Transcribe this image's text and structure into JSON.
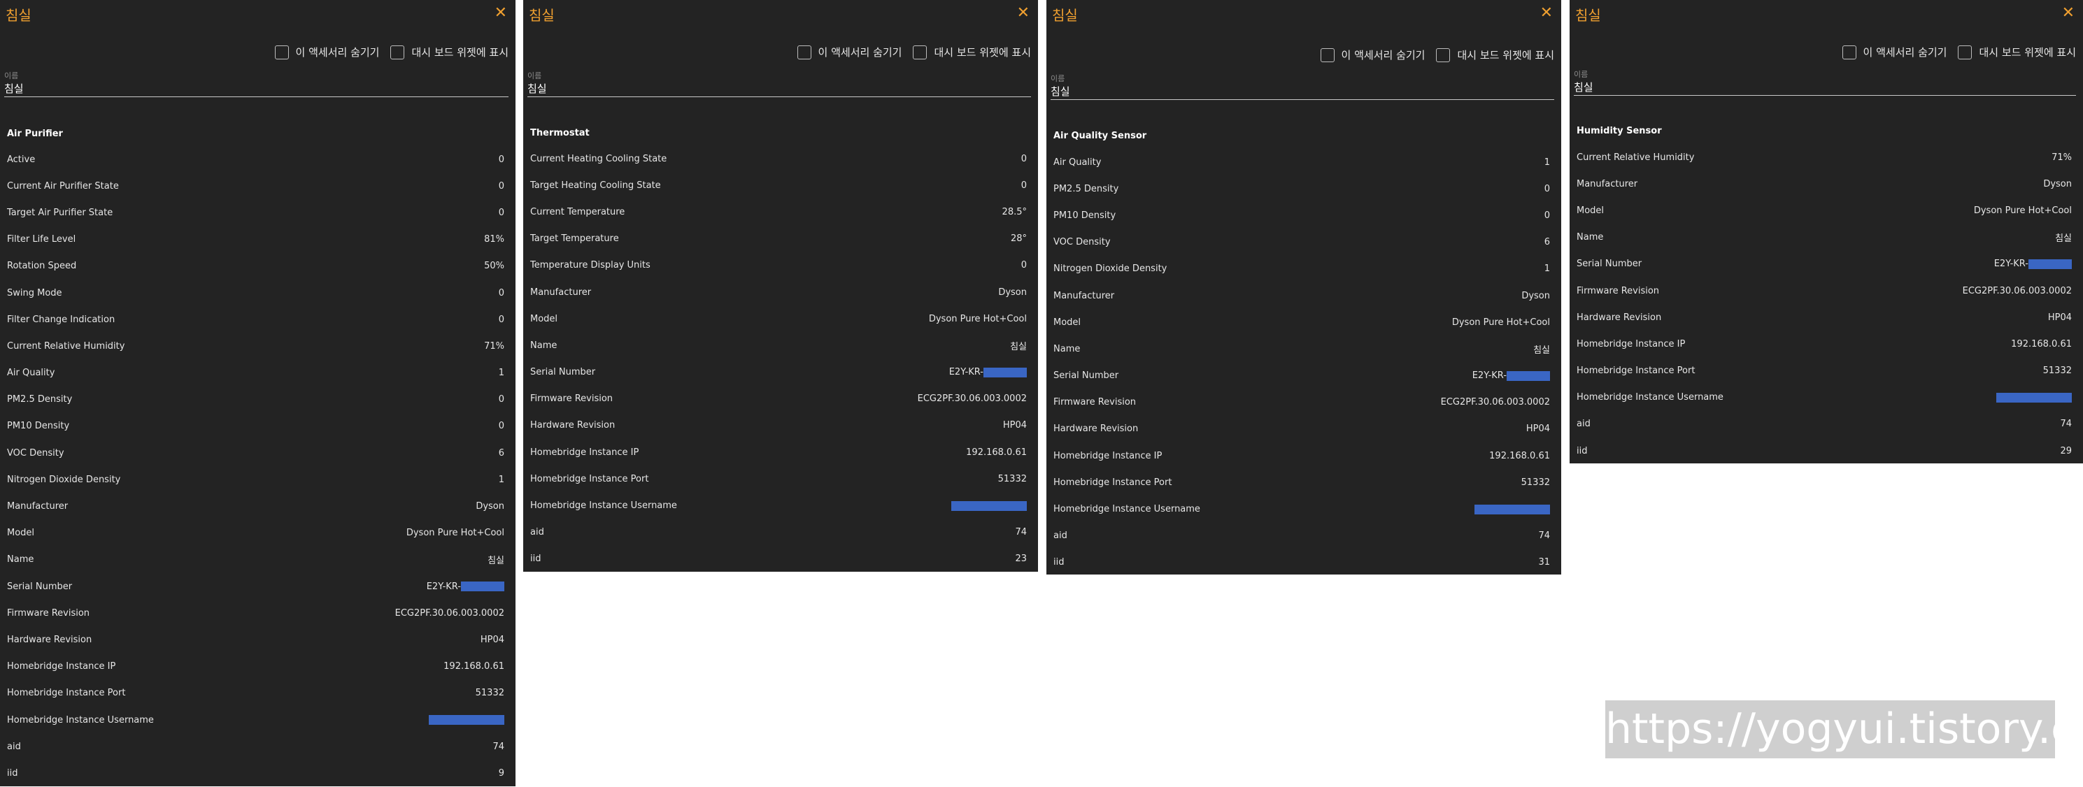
{
  "panels": [
    {
      "title": "침실",
      "hide_accessory_label": "이 액세서리 숨기기",
      "dashboard_widget_label": "대시 보드 위젯에 표시",
      "name_label": "이름",
      "name_value": "침실",
      "section": "Air Purifier",
      "rows": [
        {
          "label": "Active",
          "value": "0"
        },
        {
          "label": "Current Air Purifier State",
          "value": "0"
        },
        {
          "label": "Target Air Purifier State",
          "value": "0"
        },
        {
          "label": "Filter Life Level",
          "value": "81%"
        },
        {
          "label": "Rotation Speed",
          "value": "50%"
        },
        {
          "label": "Swing Mode",
          "value": "0"
        },
        {
          "label": "Filter Change Indication",
          "value": "0"
        },
        {
          "label": "Current Relative Humidity",
          "value": "71%"
        },
        {
          "label": "Air Quality",
          "value": "1"
        },
        {
          "label": "PM2.5 Density",
          "value": "0"
        },
        {
          "label": "PM10 Density",
          "value": "0"
        },
        {
          "label": "VOC Density",
          "value": "6"
        },
        {
          "label": "Nitrogen Dioxide Density",
          "value": "1"
        },
        {
          "label": "Manufacturer",
          "value": "Dyson"
        },
        {
          "label": "Model",
          "value": "Dyson Pure Hot+Cool"
        },
        {
          "label": "Name",
          "value": "침실"
        },
        {
          "label": "Serial Number",
          "value": "E2Y-KR-"
        },
        {
          "label": "Firmware Revision",
          "value": "ECG2PF.30.06.003.0002"
        },
        {
          "label": "Hardware Revision",
          "value": "HP04"
        },
        {
          "label": "Homebridge Instance IP",
          "value": "192.168.0.61"
        },
        {
          "label": "Homebridge Instance Port",
          "value": "51332"
        },
        {
          "label": "Homebridge Instance Username",
          "value": ""
        },
        {
          "label": "aid",
          "value": "74"
        },
        {
          "label": "iid",
          "value": "9"
        }
      ]
    },
    {
      "title": "침실",
      "hide_accessory_label": "이 액세서리 숨기기",
      "dashboard_widget_label": "대시 보드 위젯에 표시",
      "name_label": "이름",
      "name_value": "침실",
      "section": "Thermostat",
      "rows": [
        {
          "label": "Current Heating Cooling State",
          "value": "0"
        },
        {
          "label": "Target Heating Cooling State",
          "value": "0"
        },
        {
          "label": "Current Temperature",
          "value": "28.5°"
        },
        {
          "label": "Target Temperature",
          "value": "28°"
        },
        {
          "label": "Temperature Display Units",
          "value": "0"
        },
        {
          "label": "Manufacturer",
          "value": "Dyson"
        },
        {
          "label": "Model",
          "value": "Dyson Pure Hot+Cool"
        },
        {
          "label": "Name",
          "value": "침실"
        },
        {
          "label": "Serial Number",
          "value": "E2Y-KR-"
        },
        {
          "label": "Firmware Revision",
          "value": "ECG2PF.30.06.003.0002"
        },
        {
          "label": "Hardware Revision",
          "value": "HP04"
        },
        {
          "label": "Homebridge Instance IP",
          "value": "192.168.0.61"
        },
        {
          "label": "Homebridge Instance Port",
          "value": "51332"
        },
        {
          "label": "Homebridge Instance Username",
          "value": ""
        },
        {
          "label": "aid",
          "value": "74"
        },
        {
          "label": "iid",
          "value": "23"
        }
      ]
    },
    {
      "title": "침실",
      "hide_accessory_label": "이 액세서리 숨기기",
      "dashboard_widget_label": "대시 보드 위젯에 표시",
      "name_label": "이름",
      "name_value": "침실",
      "section": "Air Quality Sensor",
      "rows": [
        {
          "label": "Air Quality",
          "value": "1"
        },
        {
          "label": "PM2.5 Density",
          "value": "0"
        },
        {
          "label": "PM10 Density",
          "value": "0"
        },
        {
          "label": "VOC Density",
          "value": "6"
        },
        {
          "label": "Nitrogen Dioxide Density",
          "value": "1"
        },
        {
          "label": "Manufacturer",
          "value": "Dyson"
        },
        {
          "label": "Model",
          "value": "Dyson Pure Hot+Cool"
        },
        {
          "label": "Name",
          "value": "침실"
        },
        {
          "label": "Serial Number",
          "value": "E2Y-KR-"
        },
        {
          "label": "Firmware Revision",
          "value": "ECG2PF.30.06.003.0002"
        },
        {
          "label": "Hardware Revision",
          "value": "HP04"
        },
        {
          "label": "Homebridge Instance IP",
          "value": "192.168.0.61"
        },
        {
          "label": "Homebridge Instance Port",
          "value": "51332"
        },
        {
          "label": "Homebridge Instance Username",
          "value": ""
        },
        {
          "label": "aid",
          "value": "74"
        },
        {
          "label": "iid",
          "value": "31"
        }
      ]
    },
    {
      "title": "침실",
      "hide_accessory_label": "이 액세서리 숨기기",
      "dashboard_widget_label": "대시 보드 위젯에 표시",
      "name_label": "이름",
      "name_value": "침실",
      "section": "Humidity Sensor",
      "rows": [
        {
          "label": "Current Relative Humidity",
          "value": "71%"
        },
        {
          "label": "Manufacturer",
          "value": "Dyson"
        },
        {
          "label": "Model",
          "value": "Dyson Pure Hot+Cool"
        },
        {
          "label": "Name",
          "value": "침실"
        },
        {
          "label": "Serial Number",
          "value": "E2Y-KR-"
        },
        {
          "label": "Firmware Revision",
          "value": "ECG2PF.30.06.003.0002"
        },
        {
          "label": "Hardware Revision",
          "value": "HP04"
        },
        {
          "label": "Homebridge Instance IP",
          "value": "192.168.0.61"
        },
        {
          "label": "Homebridge Instance Port",
          "value": "51332"
        },
        {
          "label": "Homebridge Instance Username",
          "value": ""
        },
        {
          "label": "aid",
          "value": "74"
        },
        {
          "label": "iid",
          "value": "29"
        }
      ]
    }
  ],
  "watermark": "https://yogyui.tistory.com",
  "colors": {
    "accent": "#f0a030",
    "panel_bg": "#232323",
    "redaction": "#3a66c4"
  }
}
